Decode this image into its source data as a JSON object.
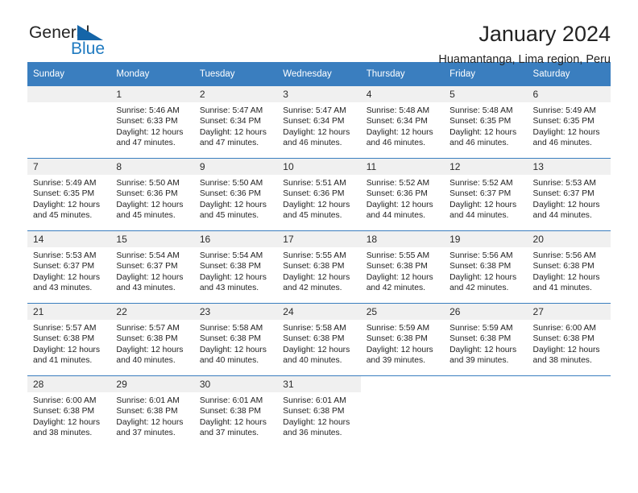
{
  "brand": {
    "name_part1": "General",
    "name_part2": "Blue",
    "triangle_color": "#1565a8",
    "blue_color": "#1f7ac0"
  },
  "header": {
    "title": "January 2024",
    "subtitle": "Huamantanga, Lima region, Peru"
  },
  "theme": {
    "header_bg": "#3a7ebf",
    "daynum_bg": "#f0f0f0",
    "cell_bg": "#ffffff",
    "text": "#1f1f1f"
  },
  "weekdays": [
    "Sunday",
    "Monday",
    "Tuesday",
    "Wednesday",
    "Thursday",
    "Friday",
    "Saturday"
  ],
  "calendar": {
    "weeks": [
      [
        {
          "day": "",
          "empty": true,
          "lines": []
        },
        {
          "day": "1",
          "lines": [
            "Sunrise: 5:46 AM",
            "Sunset: 6:33 PM",
            "Daylight: 12 hours",
            "and 47 minutes."
          ]
        },
        {
          "day": "2",
          "lines": [
            "Sunrise: 5:47 AM",
            "Sunset: 6:34 PM",
            "Daylight: 12 hours",
            "and 47 minutes."
          ]
        },
        {
          "day": "3",
          "lines": [
            "Sunrise: 5:47 AM",
            "Sunset: 6:34 PM",
            "Daylight: 12 hours",
            "and 46 minutes."
          ]
        },
        {
          "day": "4",
          "lines": [
            "Sunrise: 5:48 AM",
            "Sunset: 6:34 PM",
            "Daylight: 12 hours",
            "and 46 minutes."
          ]
        },
        {
          "day": "5",
          "lines": [
            "Sunrise: 5:48 AM",
            "Sunset: 6:35 PM",
            "Daylight: 12 hours",
            "and 46 minutes."
          ]
        },
        {
          "day": "6",
          "lines": [
            "Sunrise: 5:49 AM",
            "Sunset: 6:35 PM",
            "Daylight: 12 hours",
            "and 46 minutes."
          ]
        }
      ],
      [
        {
          "day": "7",
          "lines": [
            "Sunrise: 5:49 AM",
            "Sunset: 6:35 PM",
            "Daylight: 12 hours",
            "and 45 minutes."
          ]
        },
        {
          "day": "8",
          "lines": [
            "Sunrise: 5:50 AM",
            "Sunset: 6:36 PM",
            "Daylight: 12 hours",
            "and 45 minutes."
          ]
        },
        {
          "day": "9",
          "lines": [
            "Sunrise: 5:50 AM",
            "Sunset: 6:36 PM",
            "Daylight: 12 hours",
            "and 45 minutes."
          ]
        },
        {
          "day": "10",
          "lines": [
            "Sunrise: 5:51 AM",
            "Sunset: 6:36 PM",
            "Daylight: 12 hours",
            "and 45 minutes."
          ]
        },
        {
          "day": "11",
          "lines": [
            "Sunrise: 5:52 AM",
            "Sunset: 6:36 PM",
            "Daylight: 12 hours",
            "and 44 minutes."
          ]
        },
        {
          "day": "12",
          "lines": [
            "Sunrise: 5:52 AM",
            "Sunset: 6:37 PM",
            "Daylight: 12 hours",
            "and 44 minutes."
          ]
        },
        {
          "day": "13",
          "lines": [
            "Sunrise: 5:53 AM",
            "Sunset: 6:37 PM",
            "Daylight: 12 hours",
            "and 44 minutes."
          ]
        }
      ],
      [
        {
          "day": "14",
          "lines": [
            "Sunrise: 5:53 AM",
            "Sunset: 6:37 PM",
            "Daylight: 12 hours",
            "and 43 minutes."
          ]
        },
        {
          "day": "15",
          "lines": [
            "Sunrise: 5:54 AM",
            "Sunset: 6:37 PM",
            "Daylight: 12 hours",
            "and 43 minutes."
          ]
        },
        {
          "day": "16",
          "lines": [
            "Sunrise: 5:54 AM",
            "Sunset: 6:38 PM",
            "Daylight: 12 hours",
            "and 43 minutes."
          ]
        },
        {
          "day": "17",
          "lines": [
            "Sunrise: 5:55 AM",
            "Sunset: 6:38 PM",
            "Daylight: 12 hours",
            "and 42 minutes."
          ]
        },
        {
          "day": "18",
          "lines": [
            "Sunrise: 5:55 AM",
            "Sunset: 6:38 PM",
            "Daylight: 12 hours",
            "and 42 minutes."
          ]
        },
        {
          "day": "19",
          "lines": [
            "Sunrise: 5:56 AM",
            "Sunset: 6:38 PM",
            "Daylight: 12 hours",
            "and 42 minutes."
          ]
        },
        {
          "day": "20",
          "lines": [
            "Sunrise: 5:56 AM",
            "Sunset: 6:38 PM",
            "Daylight: 12 hours",
            "and 41 minutes."
          ]
        }
      ],
      [
        {
          "day": "21",
          "lines": [
            "Sunrise: 5:57 AM",
            "Sunset: 6:38 PM",
            "Daylight: 12 hours",
            "and 41 minutes."
          ]
        },
        {
          "day": "22",
          "lines": [
            "Sunrise: 5:57 AM",
            "Sunset: 6:38 PM",
            "Daylight: 12 hours",
            "and 40 minutes."
          ]
        },
        {
          "day": "23",
          "lines": [
            "Sunrise: 5:58 AM",
            "Sunset: 6:38 PM",
            "Daylight: 12 hours",
            "and 40 minutes."
          ]
        },
        {
          "day": "24",
          "lines": [
            "Sunrise: 5:58 AM",
            "Sunset: 6:38 PM",
            "Daylight: 12 hours",
            "and 40 minutes."
          ]
        },
        {
          "day": "25",
          "lines": [
            "Sunrise: 5:59 AM",
            "Sunset: 6:38 PM",
            "Daylight: 12 hours",
            "and 39 minutes."
          ]
        },
        {
          "day": "26",
          "lines": [
            "Sunrise: 5:59 AM",
            "Sunset: 6:38 PM",
            "Daylight: 12 hours",
            "and 39 minutes."
          ]
        },
        {
          "day": "27",
          "lines": [
            "Sunrise: 6:00 AM",
            "Sunset: 6:38 PM",
            "Daylight: 12 hours",
            "and 38 minutes."
          ]
        }
      ],
      [
        {
          "day": "28",
          "lines": [
            "Sunrise: 6:00 AM",
            "Sunset: 6:38 PM",
            "Daylight: 12 hours",
            "and 38 minutes."
          ]
        },
        {
          "day": "29",
          "lines": [
            "Sunrise: 6:01 AM",
            "Sunset: 6:38 PM",
            "Daylight: 12 hours",
            "and 37 minutes."
          ]
        },
        {
          "day": "30",
          "lines": [
            "Sunrise: 6:01 AM",
            "Sunset: 6:38 PM",
            "Daylight: 12 hours",
            "and 37 minutes."
          ]
        },
        {
          "day": "31",
          "lines": [
            "Sunrise: 6:01 AM",
            "Sunset: 6:38 PM",
            "Daylight: 12 hours",
            "and 36 minutes."
          ]
        },
        {
          "day": "",
          "empty": true,
          "blank": true,
          "lines": []
        },
        {
          "day": "",
          "empty": true,
          "blank": true,
          "lines": []
        },
        {
          "day": "",
          "empty": true,
          "blank": true,
          "lines": []
        }
      ]
    ]
  }
}
